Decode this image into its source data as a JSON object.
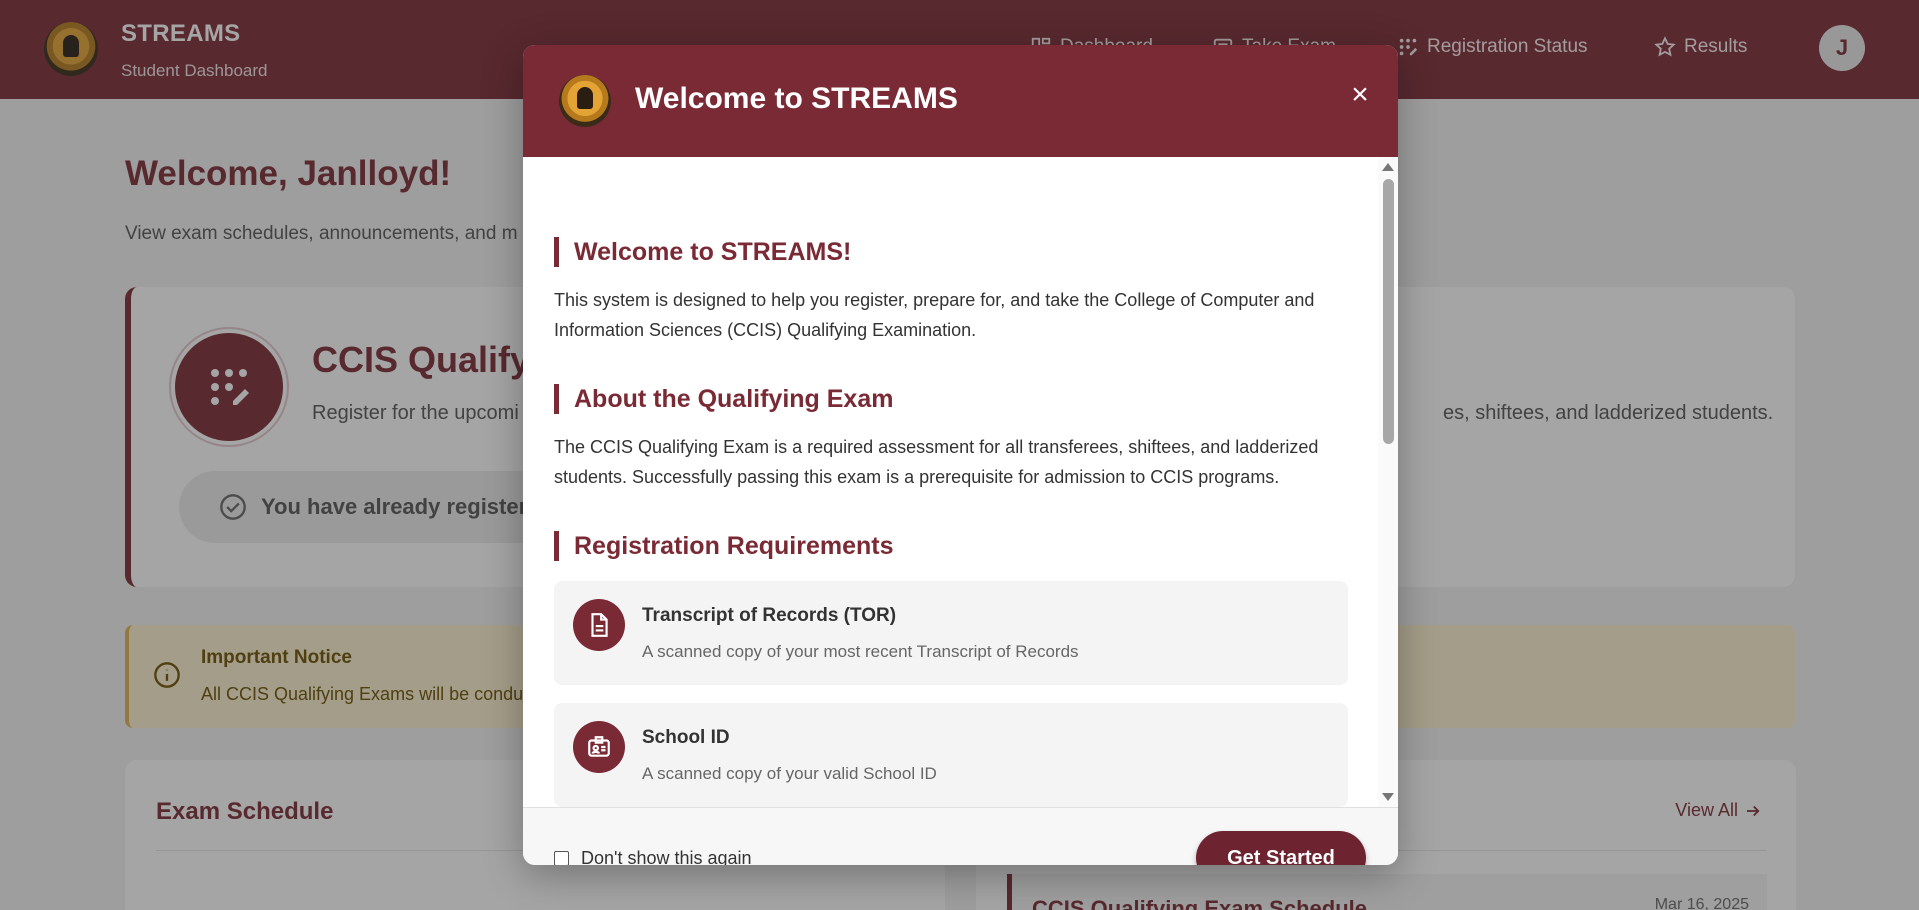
{
  "header": {
    "app_name": "STREAMS",
    "app_subtitle": "Student Dashboard",
    "nav": [
      {
        "label": "Dashboard",
        "icon": "dashboard-icon"
      },
      {
        "label": "Take Exam",
        "icon": "exam-icon"
      },
      {
        "label": "Registration Status",
        "icon": "registration-icon"
      },
      {
        "label": "Results",
        "icon": "star-icon"
      }
    ],
    "avatar_initial": "J"
  },
  "page": {
    "welcome": "Welcome, Janlloyd!",
    "welcome_sub": "View exam schedules, announcements, and m",
    "ccis_title": "CCIS Qualifyi",
    "ccis_desc_left": "Register for the upcomi",
    "ccis_desc_right": "es, shiftees, and ladderized students.",
    "registered_text": "You have already registere",
    "notice_title": "Important Notice",
    "notice_text": "All CCIS Qualifying Exams will be conducte",
    "schedule_title": "Exam Schedule",
    "view_all": "View All",
    "announcement_title": "CCIS Qualifying Exam Schedule",
    "announcement_date": "Mar 16, 2025"
  },
  "modal": {
    "title": "Welcome to STREAMS",
    "close_label": "×",
    "sections": [
      {
        "heading": "Welcome to STREAMS!",
        "text": "This system is designed to help you register, prepare for, and take the College of Computer and Information Sciences (CCIS) Qualifying Examination."
      },
      {
        "heading": "About the Qualifying Exam",
        "text": "The CCIS Qualifying Exam is a required assessment for all transferees, shiftees, and ladderized students. Successfully passing this exam is a prerequisite for admission to CCIS programs."
      },
      {
        "heading": "Registration Requirements"
      }
    ],
    "requirements": [
      {
        "title": "Transcript of Records (TOR)",
        "desc": "A scanned copy of your most recent Transcript of Records",
        "icon": "document-icon"
      },
      {
        "title": "School ID",
        "desc": "A scanned copy of your valid School ID",
        "icon": "id-card-icon"
      }
    ],
    "dont_show": "Don't show this again",
    "dont_show_checked": false,
    "cta": "Get Started"
  },
  "colors": {
    "brand": "#7a2a35",
    "brand_dark": "#6d2430",
    "notice_bg": "#fdf2cf",
    "notice_text": "#6b5000"
  }
}
